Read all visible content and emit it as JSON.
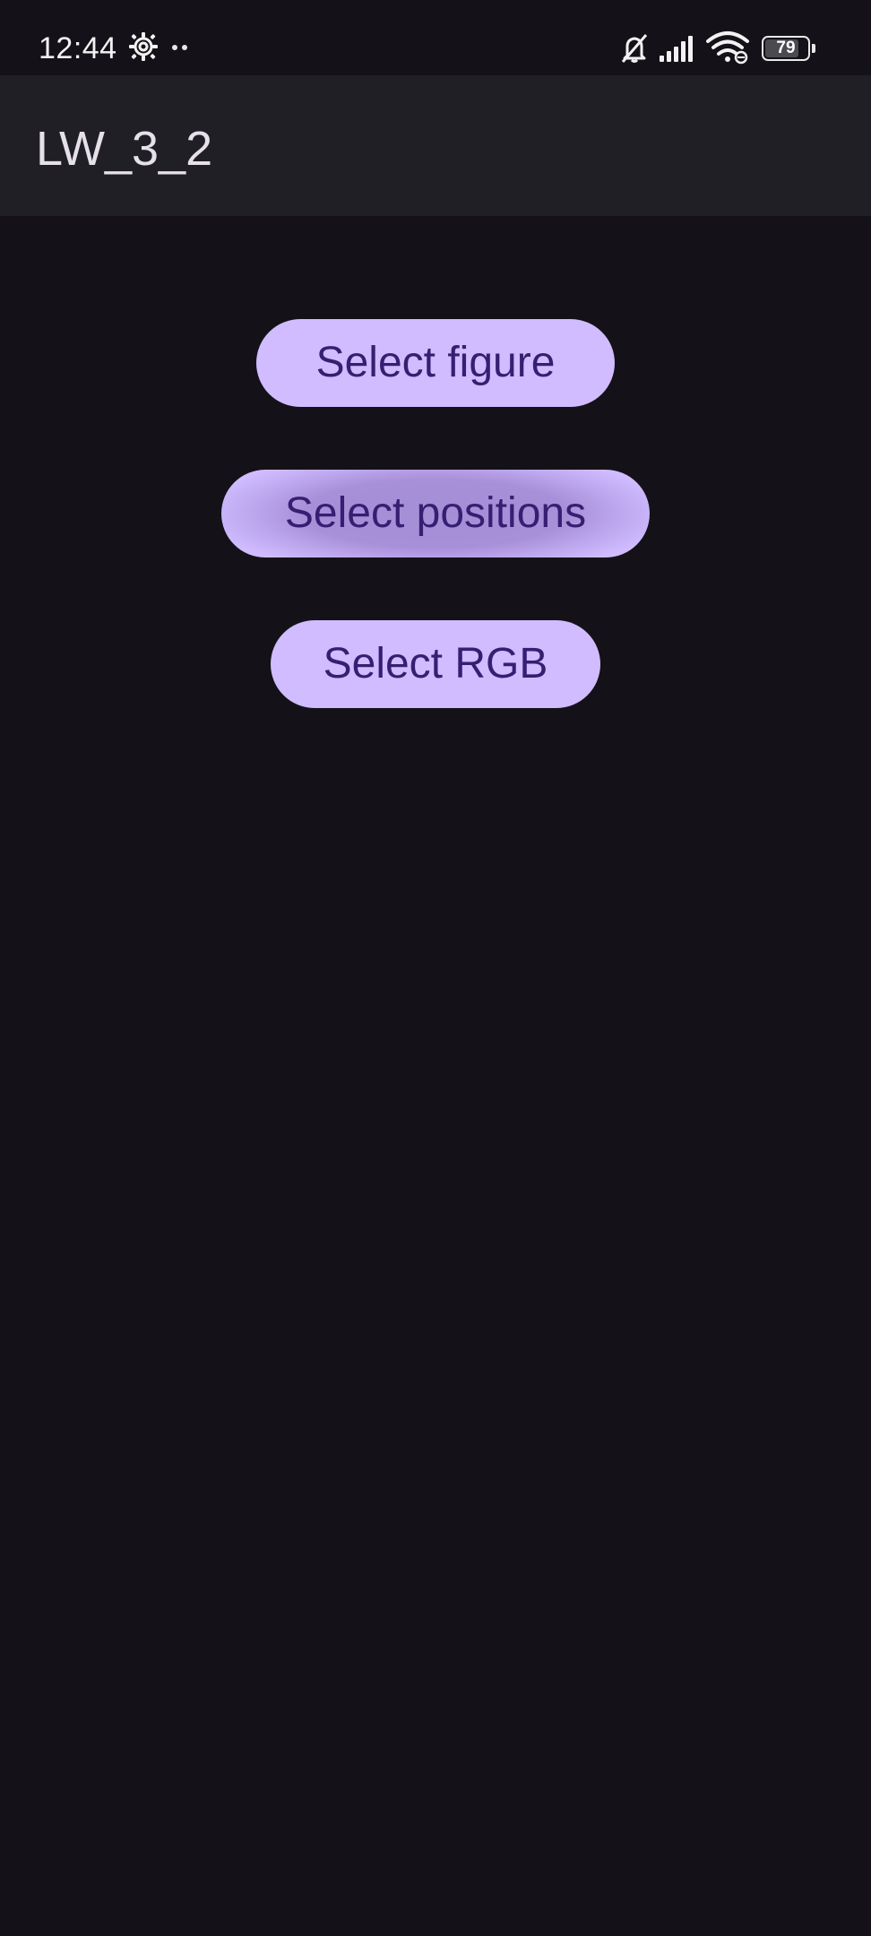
{
  "status_bar": {
    "time": "12:44",
    "battery_level": "79",
    "icons": [
      "settings-icon",
      "notification-dots-icon",
      "bell-muted-icon",
      "signal-icon",
      "wifi-icon",
      "battery-icon"
    ]
  },
  "app_bar": {
    "title": "LW_3_2"
  },
  "main": {
    "buttons": [
      {
        "label": "Select figure"
      },
      {
        "label": "Select positions"
      },
      {
        "label": "Select RGB"
      }
    ]
  },
  "colors": {
    "background": "#141218",
    "app_bar": "#211f26",
    "button_bg": "#d0bcff",
    "button_text": "#381e72",
    "title_text": "#e6e0e9"
  }
}
